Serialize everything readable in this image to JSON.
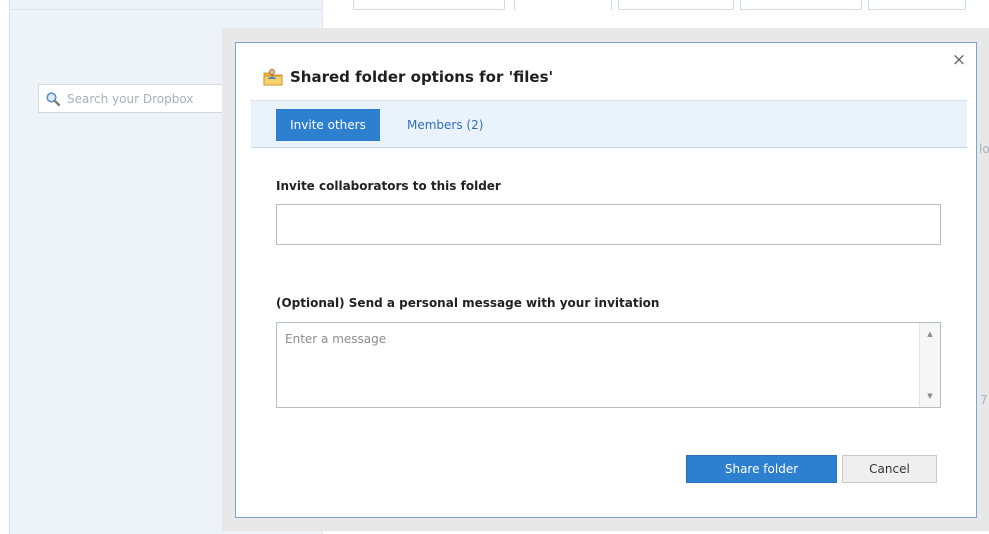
{
  "search": {
    "placeholder": "Search your Dropbox"
  },
  "background": {
    "edge_text_1": "lo",
    "edge_text_2": "7"
  },
  "dialog": {
    "title": "Shared folder options for 'files'",
    "close_label": "×",
    "tabs": [
      {
        "label": "Invite others",
        "active": true
      },
      {
        "label": "Members (2)",
        "active": false
      }
    ],
    "invite_label": "Invite collaborators to this folder",
    "invite_value": "",
    "message_label": "(Optional) Send a personal message with your invitation",
    "message_placeholder": "Enter a message",
    "share_button": "Share folder",
    "cancel_button": "Cancel"
  },
  "colors": {
    "accent": "#2d7fd0",
    "tab_bar_bg": "#eaf2fb",
    "overlay": "#e8e8e8",
    "sidebar_bg": "#eef3f9"
  },
  "icons": [
    "search-icon",
    "shared-folder-icon",
    "close-icon",
    "scroll-up-arrow-icon",
    "scroll-down-arrow-icon"
  ]
}
